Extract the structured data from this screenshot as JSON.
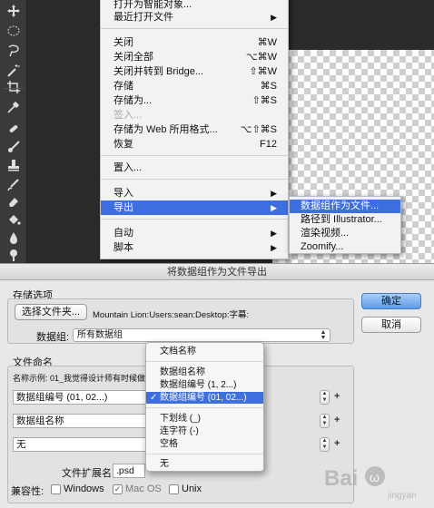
{
  "file_menu": {
    "items": [
      {
        "label": "打开为智能对象...",
        "shortcut": ""
      },
      {
        "label": "最近打开文件",
        "shortcut": "",
        "submenu": true
      },
      {
        "label": "关闭",
        "shortcut": "⌘W"
      },
      {
        "label": "关闭全部",
        "shortcut": "⌥⌘W"
      },
      {
        "label": "关闭并转到 Bridge...",
        "shortcut": "⇧⌘W"
      },
      {
        "label": "存储",
        "shortcut": "⌘S"
      },
      {
        "label": "存储为...",
        "shortcut": "⇧⌘S"
      },
      {
        "label": "签入...",
        "shortcut": "",
        "disabled": true
      },
      {
        "label": "存储为 Web 所用格式...",
        "shortcut": "⌥⇧⌘S"
      },
      {
        "label": "恢复",
        "shortcut": "F12"
      },
      {
        "label": "置入...",
        "shortcut": ""
      },
      {
        "label": "导入",
        "shortcut": "",
        "submenu": true
      },
      {
        "label": "导出",
        "shortcut": "",
        "submenu": true,
        "highlighted": true
      },
      {
        "label": "自动",
        "shortcut": "",
        "submenu": true
      },
      {
        "label": "脚本",
        "shortcut": "",
        "submenu": true
      }
    ],
    "arrow": "▶"
  },
  "export_submenu": {
    "items": [
      {
        "label": "数据组作为文件...",
        "highlighted": true
      },
      {
        "label": "路径到 Illustrator..."
      },
      {
        "label": "渲染视频..."
      },
      {
        "label": "Zoomify..."
      }
    ]
  },
  "dialog": {
    "title": "将数据组作为文件导出",
    "save_options": {
      "group_label": "存储选项",
      "choose_folder_button": "选择文件夹...",
      "folder_path": "Mountain Lion:Users:sean:Desktop:字幕:",
      "data_set_label": "数据组:",
      "data_set_value": "所有数据组"
    },
    "ok_button": "确定",
    "cancel_button": "取消",
    "file_naming": {
      "group_label": "文件命名",
      "example_label": "名称示例: 01_我觉得设计师有时候做得...",
      "rows": [
        {
          "value": "数据组编号 (01, 02...)"
        },
        {
          "value": "数据组名称"
        },
        {
          "value": "无"
        }
      ],
      "plus": "+",
      "extension_label": "文件扩展名:",
      "extension_value": ".psd",
      "compatibility_label": "兼容性:",
      "compat": [
        {
          "label": "Windows",
          "checked": false,
          "disabled": false
        },
        {
          "label": "Mac OS",
          "checked": true,
          "disabled": true
        },
        {
          "label": "Unix",
          "checked": false,
          "disabled": false
        }
      ]
    },
    "naming_popup": {
      "items": [
        {
          "label": "文档名称"
        },
        {
          "label": "数据组名称"
        },
        {
          "label": "数据组编号 (1, 2...)"
        },
        {
          "label": "数据组编号 (01, 02...)",
          "selected": true
        },
        {
          "label": "下划线 (_)"
        },
        {
          "label": "连字符 (-)"
        },
        {
          "label": "空格"
        },
        {
          "label": "无"
        }
      ],
      "check_glyph": "✓"
    }
  },
  "watermark": {
    "text": "Bai",
    "sub": "jingyan"
  },
  "colors": {
    "highlight": "#3d6fe0",
    "menu_bg": "#f2f2f2",
    "dark_bg": "#2b2b2b"
  }
}
